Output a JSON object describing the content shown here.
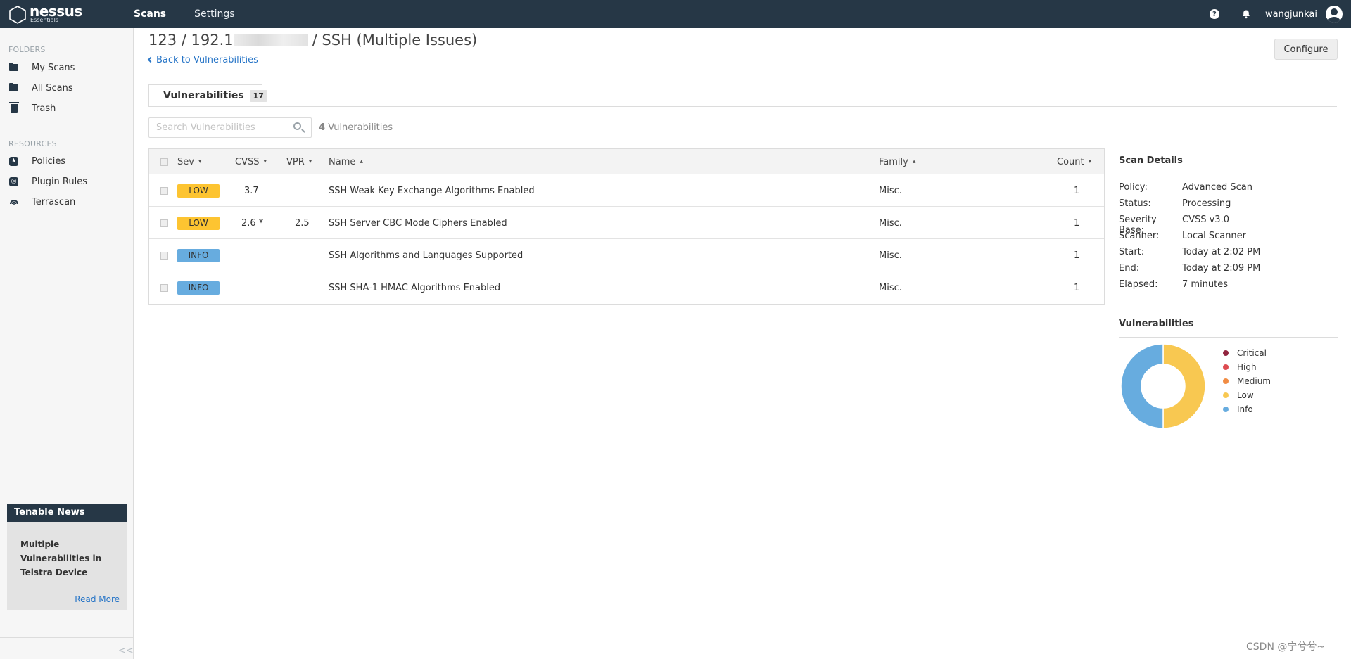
{
  "app": {
    "logo_text": "nessus",
    "logo_subtext": "Essentials",
    "nav": [
      {
        "label": "Scans",
        "active": true
      },
      {
        "label": "Settings",
        "active": false
      }
    ],
    "help_icon": "question-circle-icon",
    "notifications_icon": "bell-icon",
    "username": "wangjunkai"
  },
  "sidebar": {
    "folders_heading": "FOLDERS",
    "folders": [
      {
        "label": "My Scans",
        "icon": "folder-icon"
      },
      {
        "label": "All Scans",
        "icon": "folder-icon"
      },
      {
        "label": "Trash",
        "icon": "trash-icon"
      }
    ],
    "resources_heading": "RESOURCES",
    "resources": [
      {
        "label": "Policies",
        "icon": "policy-icon"
      },
      {
        "label": "Plugin Rules",
        "icon": "plugin-rules-icon"
      },
      {
        "label": "Terrascan",
        "icon": "terrascan-icon"
      }
    ],
    "news": {
      "heading": "Tenable News",
      "title": "Multiple Vulnerabilities in Telstra Device",
      "read_more": "Read More"
    },
    "collapse_label": "<<"
  },
  "header": {
    "title_prefix": "123 / 192.1",
    "title_suffix": "/ SSH (Multiple Issues)",
    "back_link": "Back to Vulnerabilities",
    "configure_label": "Configure"
  },
  "tabs": [
    {
      "label": "Vulnerabilities",
      "count": "17"
    }
  ],
  "search": {
    "placeholder": "Search Vulnerabilities",
    "count_number": "4",
    "count_label": "Vulnerabilities"
  },
  "table": {
    "columns": {
      "sev": "Sev",
      "cvss": "CVSS",
      "vpr": "VPR",
      "name": "Name",
      "family": "Family",
      "count": "Count"
    },
    "rows": [
      {
        "sev": "LOW",
        "sev_level": "low",
        "cvss": "3.7",
        "vpr": "",
        "name": "SSH Weak Key Exchange Algorithms Enabled",
        "family": "Misc.",
        "count": "1"
      },
      {
        "sev": "LOW",
        "sev_level": "low",
        "cvss": "2.6 *",
        "vpr": "2.5",
        "name": "SSH Server CBC Mode Ciphers Enabled",
        "family": "Misc.",
        "count": "1"
      },
      {
        "sev": "INFO",
        "sev_level": "info",
        "cvss": "",
        "vpr": "",
        "name": "SSH Algorithms and Languages Supported",
        "family": "Misc.",
        "count": "1"
      },
      {
        "sev": "INFO",
        "sev_level": "info",
        "cvss": "",
        "vpr": "",
        "name": "SSH SHA-1 HMAC Algorithms Enabled",
        "family": "Misc.",
        "count": "1"
      }
    ]
  },
  "scan_details": {
    "heading": "Scan Details",
    "rows": [
      {
        "key": "Policy:",
        "value": "Advanced Scan"
      },
      {
        "key": "Status:",
        "value": "Processing"
      },
      {
        "key": "Severity Base:",
        "value": "CVSS v3.0"
      },
      {
        "key": "Scanner:",
        "value": "Local Scanner"
      },
      {
        "key": "Start:",
        "value": "Today at 2:02 PM"
      },
      {
        "key": "End:",
        "value": "Today at 2:09 PM"
      },
      {
        "key": "Elapsed:",
        "value": "7 minutes"
      }
    ]
  },
  "vuln_chart": {
    "heading": "Vulnerabilities",
    "legend": [
      {
        "label": "Critical",
        "color": "#91243e"
      },
      {
        "label": "High",
        "color": "#dd4b50"
      },
      {
        "label": "Medium",
        "color": "#f18c43"
      },
      {
        "label": "Low",
        "color": "#f8c851"
      },
      {
        "label": "Info",
        "color": "#67acdf"
      }
    ],
    "slices": [
      {
        "label": "Low",
        "value": 2,
        "color": "#f8c851"
      },
      {
        "label": "Info",
        "value": 2,
        "color": "#67acdf"
      }
    ]
  },
  "watermark": "CSDN @宁兮兮~",
  "colors": {
    "topbar": "#263746",
    "link": "#2775c7",
    "sev_low": "#fdc431",
    "sev_info": "#67acdf"
  }
}
